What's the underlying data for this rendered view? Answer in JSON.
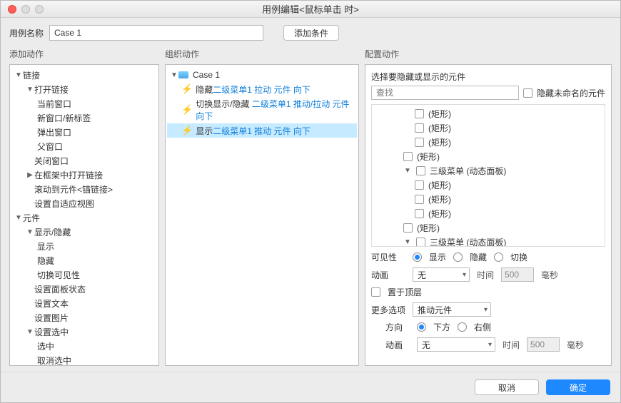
{
  "window": {
    "title": "用例编辑<鼠标单击 时>"
  },
  "toprow": {
    "name_label": "用例名称",
    "name_value": "Case 1",
    "add_condition": "添加条件"
  },
  "headings": {
    "add_action": "添加动作",
    "organize_action": "组织动作",
    "configure_action": "配置动作"
  },
  "add_tree": {
    "links": "链接",
    "open_link": "打开链接",
    "current_window": "当前窗口",
    "new_window_tab": "新窗口/新标签",
    "popup_window": "弹出窗口",
    "parent_window": "父窗口",
    "close_window": "关闭窗口",
    "open_in_frame": "在框架中打开链接",
    "scroll_to_anchor": "滚动到元件<锚链接>",
    "set_adaptive": "设置自适应视图",
    "widgets": "元件",
    "show_hide": "显示/隐藏",
    "show": "显示",
    "hide": "隐藏",
    "toggle_visibility": "切换可见性",
    "set_panel_state": "设置面板状态",
    "set_text": "设置文本",
    "set_image": "设置图片",
    "set_selected": "设置选中",
    "selected": "选中",
    "deselect": "取消选中"
  },
  "org": {
    "case": "Case 1",
    "a1_pre": "隐藏 ",
    "a1_link": "二级菜单1 拉动 元件 向下",
    "a2_pre": "切换显示/隐藏 ",
    "a2_link": "二级菜单1 推动/拉动 元件 向下",
    "a3_pre": "显示 ",
    "a3_link": "二级菜单1 推动 元件 向下"
  },
  "config": {
    "head": "选择要隐藏或显示的元件",
    "search_placeholder": "查找",
    "hide_unnamed": "隐藏未命名的元件",
    "items": {
      "rect": "(矩形)",
      "menu3": "三级菜单 (动态面板)"
    },
    "visibility_label": "可见性",
    "show": "显示",
    "hide": "隐藏",
    "toggle": "切换",
    "anim_label": "动画",
    "anim_none": "无",
    "time_label": "时间",
    "time_value": "500",
    "ms": "毫秒",
    "bring_front": "置于顶层",
    "more_options": "更多选项",
    "push_widgets": "推动元件",
    "direction": "方向",
    "below": "下方",
    "right": "右侧"
  },
  "footer": {
    "cancel": "取消",
    "ok": "确定"
  }
}
